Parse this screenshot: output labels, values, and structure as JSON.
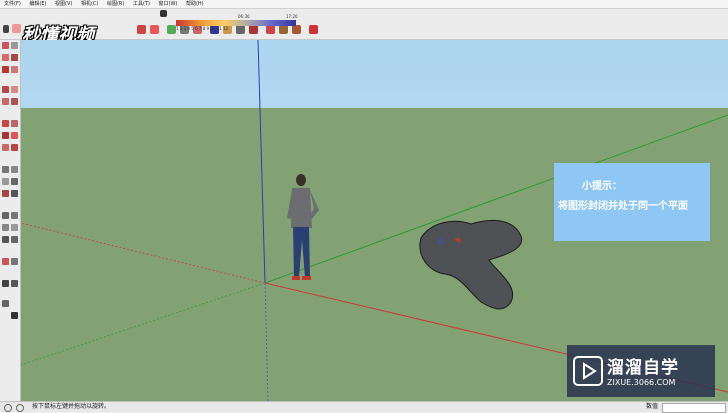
{
  "menu": {
    "items": [
      "文件(F)",
      "编辑(E)",
      "视图(V)",
      "相机(C)",
      "绘图(R)",
      "工具(T)",
      "窗口(W)",
      "帮助(H)"
    ]
  },
  "toolbar": {
    "logo": "秒懂视频",
    "sun_ticks": "1 2 3 4 5 6 7 8 9 10 11 12",
    "time_left": "06:30",
    "time_right": "17:20"
  },
  "hint": {
    "title": "小提示：",
    "body": "将图形封闭并处于同一个平面"
  },
  "watermark": {
    "title": "溜溜自学",
    "url": "ZIXUE.3066.COM"
  },
  "status": {
    "message": "按下鼠标左键并拖动以旋转。",
    "measure_label": "数值"
  },
  "colors": {
    "sky": "#aed5ef",
    "ground": "#83a274",
    "hint_bg": "#8ec6f5",
    "axis_red": "#c83a3a",
    "axis_green": "#2f9a2f",
    "axis_blue": "#2a3fb0",
    "shape_fill": "#4e5254"
  }
}
